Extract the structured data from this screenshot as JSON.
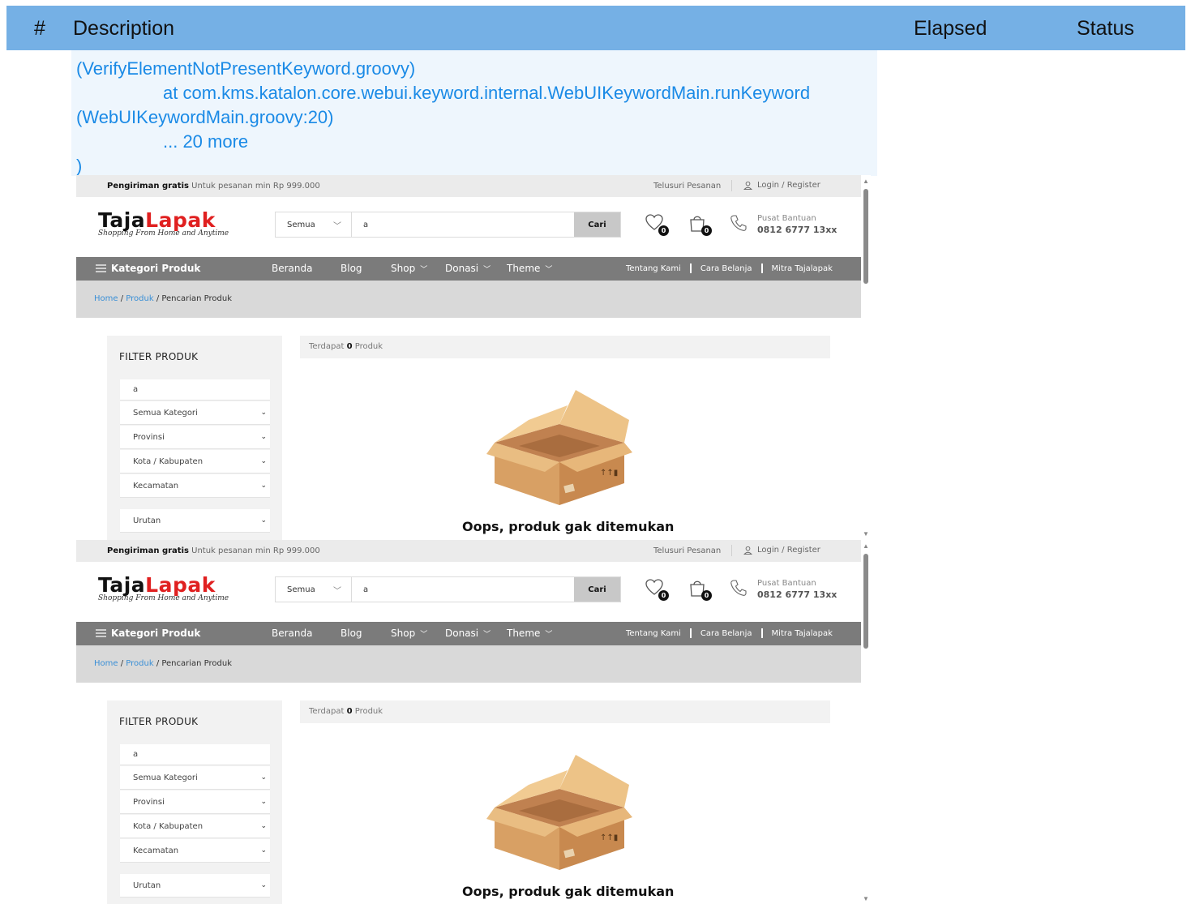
{
  "report": {
    "columns": {
      "hash": "#",
      "description": "Description",
      "elapsed": "Elapsed",
      "status": "Status"
    },
    "log_lines": [
      "(VerifyElementNotPresentKeyword.groovy)",
      "at com.kms.katalon.core.webui.keyword.internal.WebUIKeywordMain.runKeyword",
      "(WebUIKeywordMain.groovy:20)",
      "... 20 more",
      ")"
    ]
  },
  "site": {
    "topbar": {
      "promo_bold": "Pengiriman gratis",
      "promo_text": "Untuk pesanan min Rp 999.000",
      "track_order": "Telusuri Pesanan",
      "login": "Login / Register"
    },
    "logo": {
      "part1": "Taja",
      "part2": "Lapak",
      "tagline": "Shopping From Home and Anytime"
    },
    "search": {
      "category": "Semua",
      "query": "a",
      "button": "Cari"
    },
    "wishlist_count": "0",
    "cart_count": "0",
    "help": {
      "label": "Pusat Bantuan",
      "phone": "0812 6777 13xx"
    },
    "nav": {
      "categories": "Kategori Produk",
      "items": [
        "Beranda",
        "Blog",
        "Shop",
        "Donasi",
        "Theme"
      ],
      "right": [
        "Tentang Kami",
        "Cara Belanja",
        "Mitra Tajalapak"
      ]
    },
    "breadcrumb": {
      "home": "Home",
      "produk": "Produk",
      "current": "/ Pencarian Produk",
      "sep": "/"
    },
    "filter": {
      "title": "FILTER PRODUK",
      "keyword": "a",
      "selects": [
        "Semua Kategori",
        "Provinsi",
        "Kota / Kabupaten",
        "Kecamatan"
      ],
      "sort": "Urutan"
    },
    "results": {
      "prefix": "Terdapat",
      "count": "0",
      "suffix": "Produk"
    },
    "empty_message": "Oops, produk gak ditemukan"
  },
  "colors": {
    "header_bg": "#75b0e5",
    "log_text": "#1a8ae6",
    "logo_accent": "#e02020",
    "nav_bg": "#7b7b7b",
    "link": "#3a8fd6"
  }
}
